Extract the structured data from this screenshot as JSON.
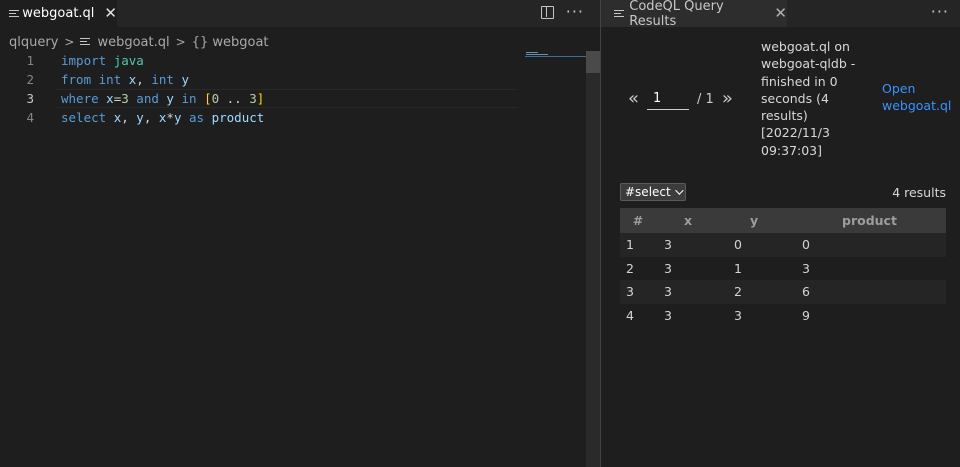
{
  "editor": {
    "tab_label": "webgoat.ql",
    "breadcrumb": {
      "folder": "qlquery",
      "file": "webgoat.ql",
      "symbol": "{} webgoat"
    },
    "lines": [
      {
        "num": "1",
        "tokens": [
          [
            "kw",
            "import"
          ],
          [
            "op",
            " "
          ],
          [
            "ty",
            "java"
          ]
        ]
      },
      {
        "num": "2",
        "tokens": [
          [
            "kw",
            "from"
          ],
          [
            "op",
            " "
          ],
          [
            "kw",
            "int"
          ],
          [
            "op",
            " "
          ],
          [
            "id",
            "x"
          ],
          [
            "op",
            ", "
          ],
          [
            "kw",
            "int"
          ],
          [
            "op",
            " "
          ],
          [
            "id",
            "y"
          ]
        ]
      },
      {
        "num": "3",
        "tokens": [
          [
            "kw",
            "where"
          ],
          [
            "op",
            " "
          ],
          [
            "id",
            "x"
          ],
          [
            "op",
            "="
          ],
          [
            "nu",
            "3"
          ],
          [
            "op",
            " "
          ],
          [
            "kw",
            "and"
          ],
          [
            "op",
            " "
          ],
          [
            "id",
            "y"
          ],
          [
            "op",
            " "
          ],
          [
            "kw",
            "in"
          ],
          [
            "op",
            " "
          ],
          [
            "br",
            "["
          ],
          [
            "nu",
            "0"
          ],
          [
            "op",
            " .. "
          ],
          [
            "nu",
            "3"
          ],
          [
            "br",
            "]"
          ]
        ]
      },
      {
        "num": "4",
        "tokens": [
          [
            "kw",
            "select"
          ],
          [
            "op",
            " "
          ],
          [
            "id",
            "x"
          ],
          [
            "op",
            ", "
          ],
          [
            "id",
            "y"
          ],
          [
            "op",
            ", "
          ],
          [
            "id",
            "x"
          ],
          [
            "op",
            "*"
          ],
          [
            "id",
            "y"
          ],
          [
            "op",
            " "
          ],
          [
            "kw",
            "as"
          ],
          [
            "op",
            " "
          ],
          [
            "id",
            "product"
          ]
        ]
      }
    ],
    "current_line": 3
  },
  "results": {
    "tab_label": "CodeQL Query Results",
    "pager": {
      "prev": "«",
      "page": "1",
      "total": "/ 1",
      "next": "»"
    },
    "run_info": "webgoat.ql on webgoat-qldb - finished in 0 seconds (4 results) [2022/11/3 09:37:03]",
    "open_link": "Open webgoat.ql",
    "select_value": "#select",
    "count": "4 results",
    "columns": [
      "#",
      "x",
      "y",
      "product"
    ],
    "rows": [
      [
        "1",
        "3",
        "0",
        "0"
      ],
      [
        "2",
        "3",
        "1",
        "3"
      ],
      [
        "3",
        "3",
        "2",
        "6"
      ],
      [
        "4",
        "3",
        "3",
        "9"
      ]
    ]
  },
  "icons": {
    "file": "file-lines-icon",
    "close": "close-icon",
    "split": "split-editor-icon",
    "more": "more-actions-icon",
    "chevron": "chevron-right-icon"
  }
}
